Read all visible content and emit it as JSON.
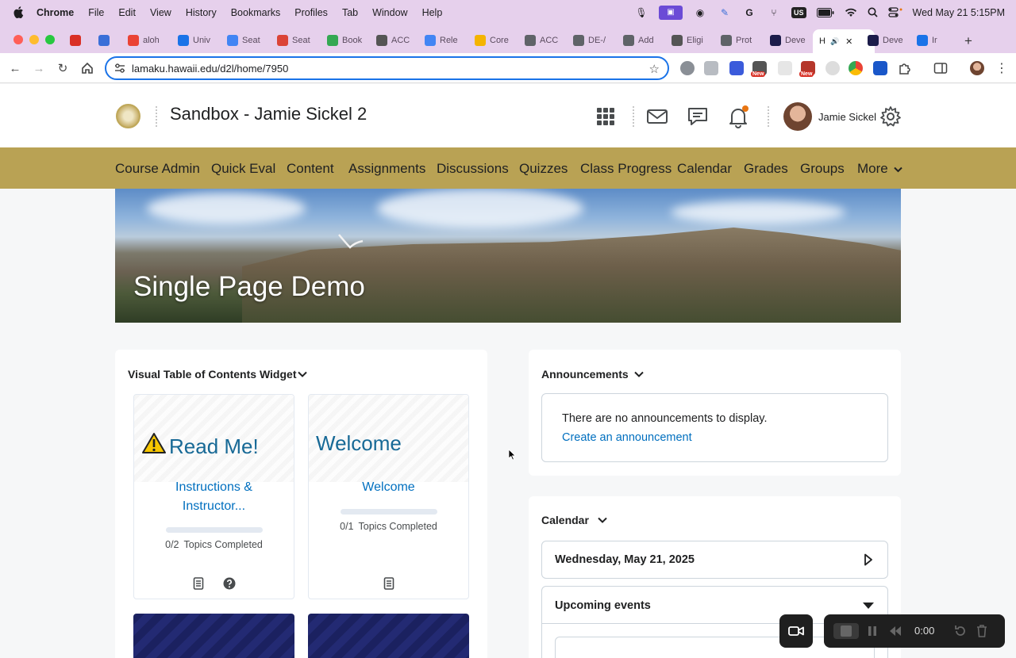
{
  "menubar": {
    "app": "Chrome",
    "items": [
      "File",
      "Edit",
      "View",
      "History",
      "Bookmarks",
      "Profiles",
      "Tab",
      "Window",
      "Help"
    ],
    "keyboard": "US",
    "datetime": "Wed May 21  5:15PM"
  },
  "tabs": [
    {
      "label": "",
      "fav_color": "#d93025",
      "icon": "record-tab-icon"
    },
    {
      "label": "",
      "fav_color": "#3a6fd8",
      "icon": "vpn-tab-icon"
    },
    {
      "label": "aloh",
      "fav_color": "#ea4335",
      "icon": "gmail-icon"
    },
    {
      "label": "Univ",
      "fav_color": "#1a73e8",
      "icon": "calendar-tab-icon"
    },
    {
      "label": "Seat",
      "fav_color": "#4285f4",
      "icon": "docs-tab-icon"
    },
    {
      "label": "Seat",
      "fav_color": "#db4437",
      "icon": "maps-tab-icon"
    },
    {
      "label": "Book",
      "fav_color": "#34a853",
      "icon": "book-tab-icon"
    },
    {
      "label": "ACC",
      "fav_color": "#555555",
      "icon": "a-tab-icon"
    },
    {
      "label": "Rele",
      "fav_color": "#4285f4",
      "icon": "docs-tab-icon"
    },
    {
      "label": "Core",
      "fav_color": "#f4b400",
      "icon": "slides-tab-icon"
    },
    {
      "label": "ACC",
      "fav_color": "#5f6368",
      "icon": "globe-tab-icon"
    },
    {
      "label": "DE-/",
      "fav_color": "#5f6368",
      "icon": "globe-tab-icon"
    },
    {
      "label": "Add",
      "fav_color": "#5f6368",
      "icon": "globe-tab-icon"
    },
    {
      "label": "Eligi",
      "fav_color": "#555555",
      "icon": "a-tab-icon"
    },
    {
      "label": "Prot",
      "fav_color": "#5f6368",
      "icon": "globe-tab-icon"
    },
    {
      "label": "Deve",
      "fav_color": "#1c1c4a",
      "icon": "x-tab-icon"
    },
    {
      "label": "H",
      "fav_color": "#ffffff",
      "icon": "active-tab-icon"
    },
    {
      "label": "Deve",
      "fav_color": "#1c1c4a",
      "icon": "x-tab-icon"
    },
    {
      "label": "Ir",
      "fav_color": "#1a73e8",
      "icon": "settings-tab-icon"
    }
  ],
  "address": {
    "url": "lamaku.hawaii.edu/d2l/home/7950"
  },
  "course": {
    "title": "Sandbox - Jamie Sickel 2",
    "user": "Jamie Sickel"
  },
  "nav": [
    "Course Admin",
    "Quick Eval",
    "Content",
    "Assignments",
    "Discussions",
    "Quizzes",
    "Class Progress",
    "Calendar",
    "Grades",
    "Groups",
    "More"
  ],
  "banner": {
    "title": "Single Page Demo"
  },
  "vtoc": {
    "title": "Visual Table of Contents Widget",
    "cards": [
      {
        "image_text": "Read Me!",
        "link": "Instructions & Instructor...",
        "link_line1": "Instructions &",
        "link_line2": "Instructor...",
        "completed": "0/2",
        "progress": 0,
        "topics_label": "Topics Completed"
      },
      {
        "image_text": "Welcome",
        "link": "Welcome",
        "completed": "0/1",
        "progress": 0,
        "topics_label": "Topics Completed"
      }
    ]
  },
  "announcements": {
    "title": "Announcements",
    "empty_text": "There are no announcements to display.",
    "create_link": "Create an announcement"
  },
  "calendar": {
    "title": "Calendar",
    "date": "Wednesday, May 21, 2025",
    "upcoming": "Upcoming events"
  },
  "recorder": {
    "time": "0:00"
  },
  "colors": {
    "nav_bg": "#b9a254",
    "link": "#006fbf",
    "menubar": "#e6d0ec"
  }
}
